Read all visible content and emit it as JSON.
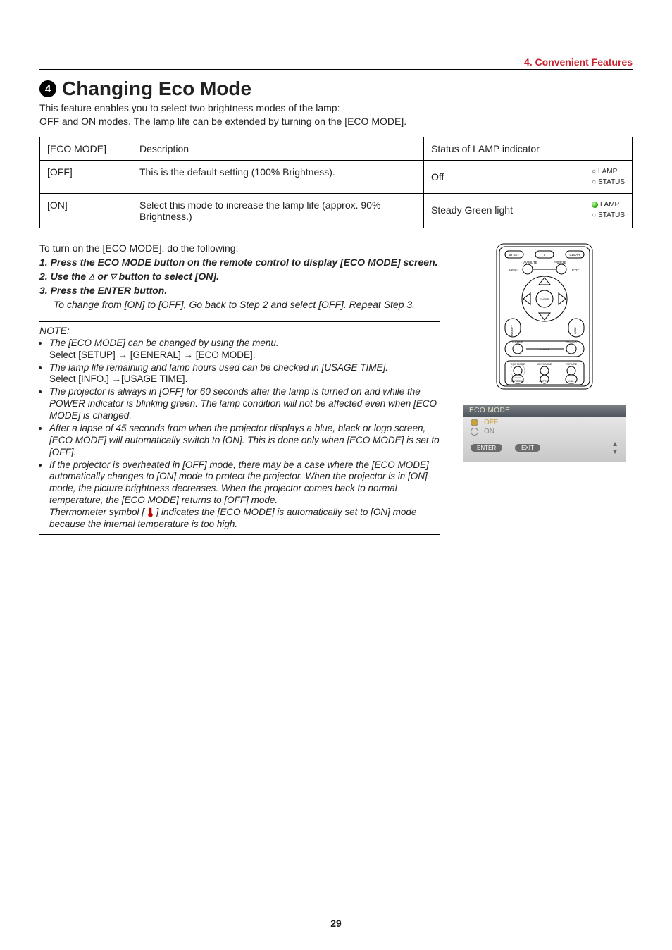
{
  "chapter_label": "4. Convenient Features",
  "heading_num": "4",
  "heading_text": "Changing Eco Mode",
  "intro_line1": "This feature enables you to select two brightness modes of the lamp:",
  "intro_line2": "OFF and ON modes. The lamp life can be extended by turning on the [ECO MODE].",
  "table": {
    "head": {
      "c1": "[ECO MODE]",
      "c2": "Description",
      "c3": "Status of LAMP indicator"
    },
    "row_off": {
      "c1": "[OFF]",
      "c2": "This is the default setting (100% Brightness).",
      "c3_text": "Off",
      "lamp": "LAMP",
      "status": "STATUS"
    },
    "row_on": {
      "c1": "[ON]",
      "c2": "Select this mode to increase the lamp life (approx. 90% Brightness.)",
      "c3_text": "Steady Green light",
      "lamp": "LAMP",
      "status": "STATUS"
    }
  },
  "steps": {
    "lead": "To turn on the [ECO MODE], do the following:",
    "s1": "1. Press the ECO MODE button on the remote control to display [ECO MODE] screen.",
    "s2_pre": "2. Use the ",
    "s2_mid": " or ",
    "s2_post": " button to select [ON].",
    "s3": "3. Press the ENTER button.",
    "s3_sub": "To change from [ON] to [OFF], Go back to Step 2 and select [OFF]. Repeat Step 3."
  },
  "note_label": "NOTE:",
  "notes": {
    "n1a": "The [ECO MODE] can be changed by using the menu.",
    "n1b": "Select [SETUP] → [GENERAL] → [ECO MODE].",
    "n2a": "The lamp life remaining and lamp hours used can be checked in [USAGE TIME].",
    "n2b": "Select [INFO.] →[USAGE TIME].",
    "n3": "The projector is always in [OFF] for 60 seconds after the lamp is turned on and while the POWER indicator is blinking green. The lamp condition will not be affected even when [ECO MODE] is changed.",
    "n4": "After a lapse of 45 seconds from when the projector displays a blue, black or logo screen, [ECO MODE] will automatically switch to [ON]. This is done only when [ECO MODE] is set to [OFF].",
    "n5a": "If the projector is overheated in [OFF] mode, there may be a case where the [ECO MODE] automatically changes to [ON] mode to protect the projector. When the projector is in [ON] mode, the picture brightness decreases. When the projector comes back to normal temperature, the [ECO MODE] returns to [OFF] mode.",
    "n5b_pre": "Thermometer symbol [ ",
    "n5b_post": " ] indicates the [ECO MODE] is automatically set to [ON] mode because the internal temperature is too high."
  },
  "remote": {
    "idset": "ID SET",
    "zero": "0",
    "clear": "CLEAR",
    "avmute": "AV-MUTE",
    "freeze": "FREEZE",
    "menu": "MENU",
    "exit": "EXIT",
    "enter": "ENTER",
    "magnify": "MAGNIFY",
    "page": "PAGE",
    "lclick": "L-CLICK",
    "rclick": "R-CLICK",
    "mouse": "MOUSE",
    "ecomode": "ECO MODE",
    "keystone": "KEYSTONE",
    "picture": "PICTURE",
    "dfocus": "D-FOCUS",
    "aspect": "ASPECT",
    "vol": "VOL."
  },
  "dialog": {
    "title": "ECO MODE",
    "off": "OFF",
    "on": "ON",
    "enter": "ENTER",
    "exit": "EXIT"
  },
  "page_number": "29"
}
